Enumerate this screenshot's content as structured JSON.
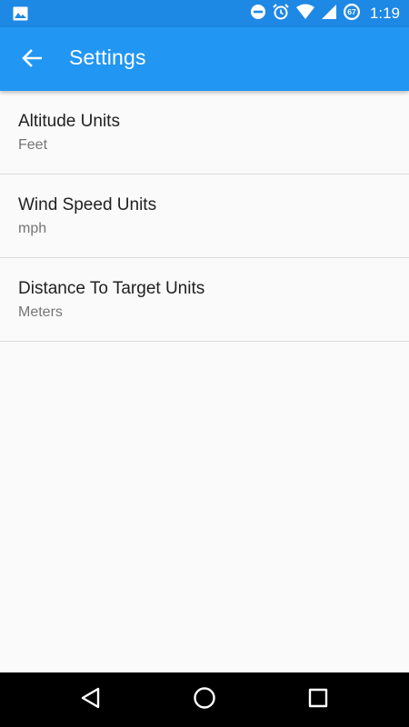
{
  "status_bar": {
    "time": "1:19",
    "battery_level": "67",
    "icons": [
      "image-icon",
      "do-not-disturb-icon",
      "alarm-icon",
      "wifi-icon",
      "signal-icon",
      "battery-icon"
    ]
  },
  "app_bar": {
    "title": "Settings",
    "back_icon": "arrow-back-icon",
    "color": "#2196f3",
    "status_color": "#1e88e5"
  },
  "preferences": [
    {
      "title": "Altitude Units",
      "summary": "Feet"
    },
    {
      "title": "Wind Speed Units",
      "summary": "mph"
    },
    {
      "title": "Distance To Target Units",
      "summary": "Meters"
    }
  ],
  "nav_bar": {
    "buttons": [
      "back-triangle-icon",
      "home-circle-icon",
      "recents-square-icon"
    ]
  }
}
